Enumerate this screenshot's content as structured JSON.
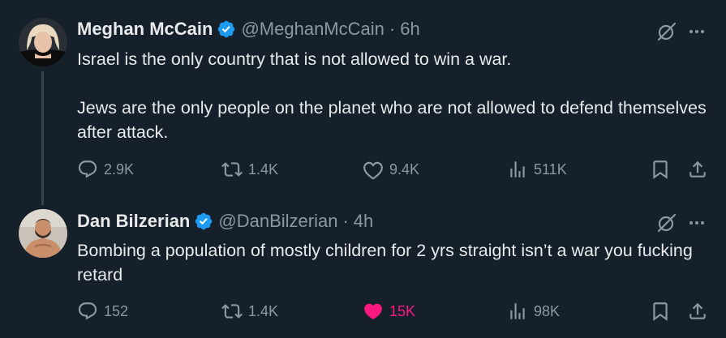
{
  "tweets": [
    {
      "author_name": "Meghan McCain",
      "handle": "@MeghanMcCain",
      "separator": "·",
      "time": "6h",
      "paragraphs": [
        "Israel is the only country that is not allowed to win a war.",
        "Jews are the only people on the planet who are not allowed to defend themselves after attack."
      ],
      "replies": "2.9K",
      "reposts": "1.4K",
      "likes": "9.4K",
      "views": "511K",
      "liked": false,
      "avatar_icon": "avatar-blonde-woman"
    },
    {
      "author_name": "Dan Bilzerian",
      "handle": "@DanBilzerian",
      "separator": "·",
      "time": "4h",
      "paragraphs": [
        "Bombing a population of mostly children for 2 yrs straight isn’t a war you fucking retard"
      ],
      "replies": "152",
      "reposts": "1.4K",
      "likes": "15K",
      "views": "98K",
      "liked": true,
      "avatar_icon": "avatar-bearded-man"
    }
  ],
  "colors": {
    "background": "#15202b",
    "text": "#e7e9ea",
    "muted": "#8b98a5",
    "verified": "#1d9bf0",
    "like_active": "#f91880",
    "thread_line": "#38444d"
  },
  "icons": [
    "verified-badge-icon",
    "grok-icon",
    "more-icon",
    "reply-icon",
    "repost-icon",
    "like-icon",
    "views-icon",
    "bookmark-icon",
    "share-icon"
  ]
}
